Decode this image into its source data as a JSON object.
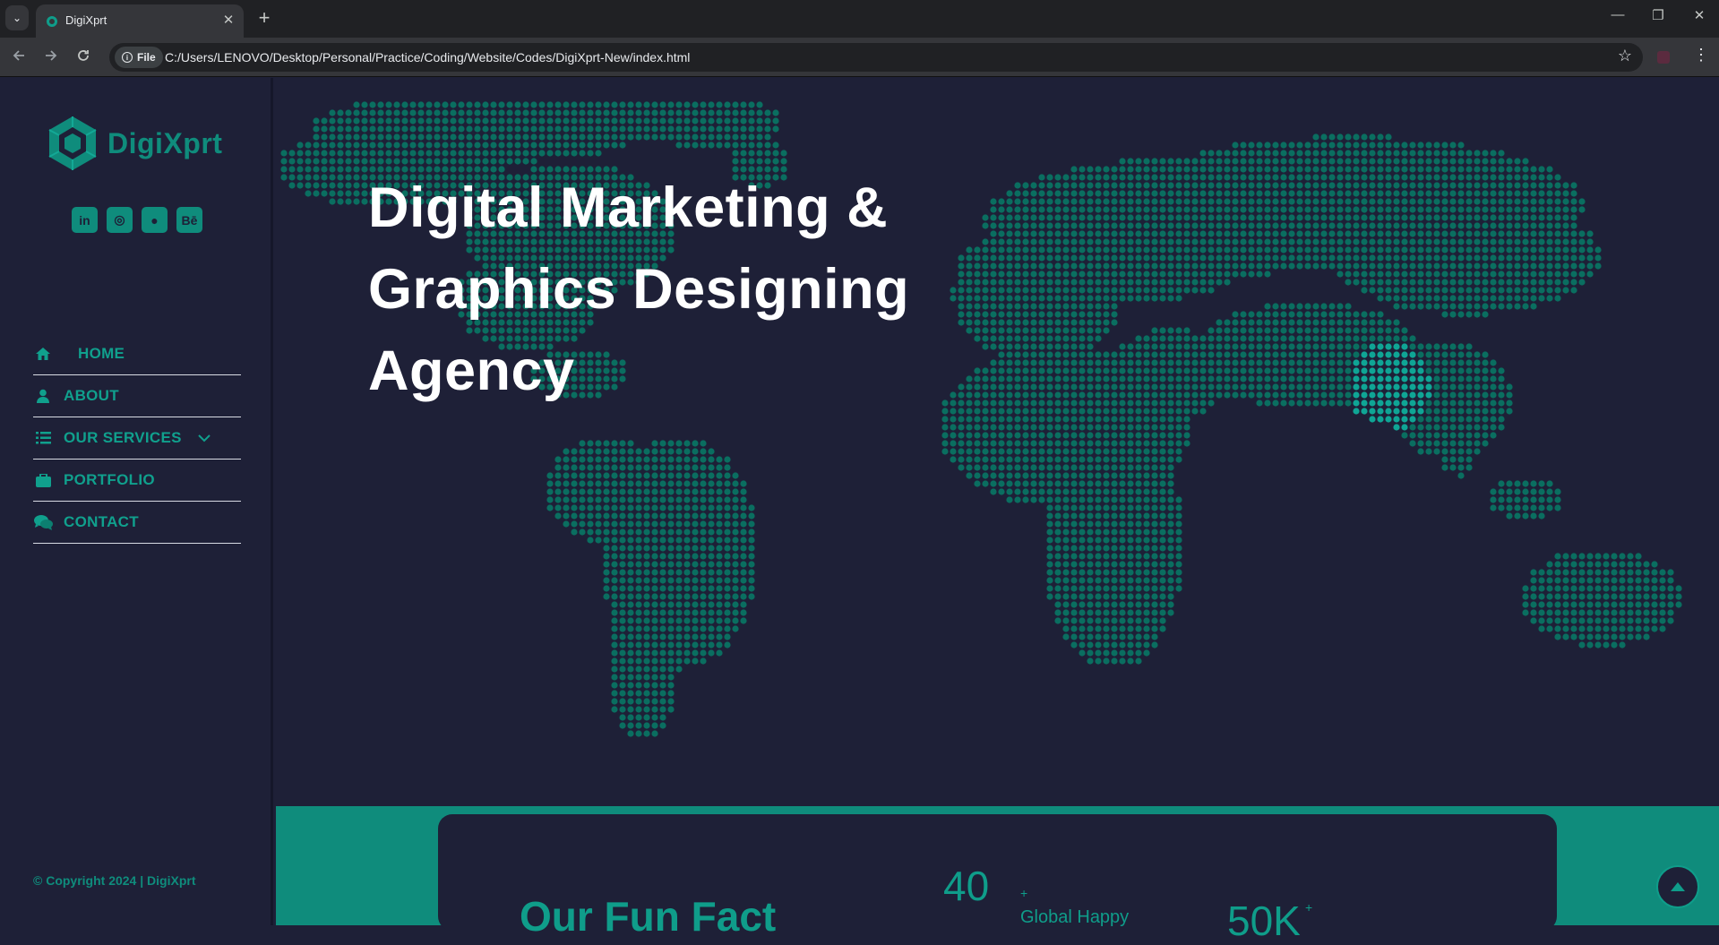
{
  "browser": {
    "tab_title": "DigiXprt",
    "close_glyph": "✕",
    "new_tab_glyph": "+",
    "site_chip": "File",
    "url": "C:/Users/LENOVO/Desktop/Personal/Practice/Coding/Website/Codes/DigiXprt-New/index.html",
    "minimize_glyph": "—",
    "restore_glyph": "❐",
    "window_close_glyph": "✕"
  },
  "sidebar": {
    "logo_text": "DigiXprt",
    "socials": [
      {
        "name": "linkedin-icon",
        "glyph": "in"
      },
      {
        "name": "instagram-icon",
        "glyph": "◎"
      },
      {
        "name": "github-icon",
        "glyph": "●"
      },
      {
        "name": "behance-icon",
        "glyph": "Bē"
      }
    ],
    "nav": [
      {
        "label": "HOME",
        "icon": "home-icon"
      },
      {
        "label": "ABOUT",
        "icon": "user-icon"
      },
      {
        "label": "OUR SERVICES",
        "icon": "list-icon"
      },
      {
        "label": "PORTFOLIO",
        "icon": "briefcase-icon"
      },
      {
        "label": "CONTACT",
        "icon": "comments-icon"
      }
    ],
    "copyright": "© Copyright 2024 | DigiXprt"
  },
  "hero": {
    "title_line1": "Digital Marketing &",
    "title_line2": "Graphics Designing",
    "title_line3": "Agency"
  },
  "funfact": {
    "heading": "Our Fun Fact",
    "stat1_value": "40",
    "stat1_suffix": "+",
    "stat1_label": "Global Happy",
    "stat2_value": "50K",
    "stat2_suffix": "+"
  },
  "colors": {
    "background": "#1e2037",
    "accent": "#0f8c7c",
    "map_dot": "#0a6e60",
    "map_highlight": "#0fa595"
  }
}
